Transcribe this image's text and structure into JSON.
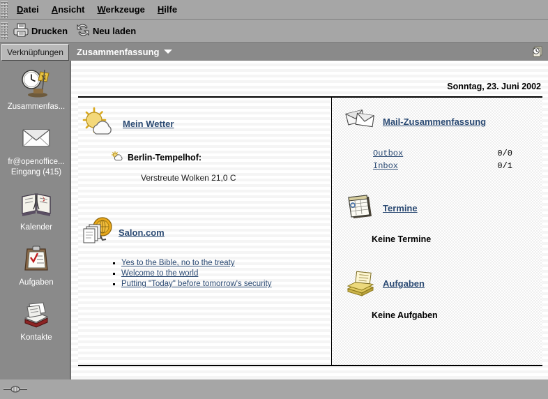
{
  "menubar": {
    "items": [
      {
        "label": "Datei",
        "accel": "D"
      },
      {
        "label": "Ansicht",
        "accel": "A"
      },
      {
        "label": "Werkzeuge",
        "accel": "W"
      },
      {
        "label": "Hilfe",
        "accel": "H"
      }
    ]
  },
  "toolbar": {
    "print_label": "Drucken",
    "print_icon": "printer-icon",
    "reload_label": "Neu laden",
    "reload_icon": "refresh-icon"
  },
  "viewbar": {
    "tab_label": "Verknüpfungen",
    "title": "Zusammenfassung",
    "dropdown_icon": "chevron-down-icon",
    "corner_icon": "summary-clock-icon"
  },
  "sidebar": {
    "items": [
      {
        "label": "Zusammenfas...",
        "label2": "",
        "icon": "clock-summary-icon"
      },
      {
        "label": "fr@openoffice...",
        "label2": "Eingang (415)",
        "icon": "envelope-icon"
      },
      {
        "label": "Kalender",
        "label2": "",
        "icon": "calendar-book-icon"
      },
      {
        "label": "Aufgaben",
        "label2": "",
        "icon": "clipboard-check-icon"
      },
      {
        "label": "Kontakte",
        "label2": "",
        "icon": "contacts-cardfile-icon"
      }
    ]
  },
  "content": {
    "date": "Sonntag, 23. Juni 2002",
    "weather": {
      "title": "Mein Wetter",
      "icon": "sun-cloud-icon",
      "station": "Berlin-Tempelhof:",
      "station_icon": "small-sun-cloud-icon",
      "condition": "Verstreute Wolken 21,0 C"
    },
    "news": {
      "title": "Salon.com",
      "icon": "news-documents-icon",
      "link_icon": "salon-globe-icon",
      "items": [
        "Yes to the Bible, no to the treaty",
        "Welcome to the world",
        "Putting \"Today\" before tomorrow's security"
      ]
    },
    "mail": {
      "title": "Mail-Zusammenfassung",
      "icon": "mail-stack-icon",
      "folders": [
        {
          "name": "Outbox",
          "count": "0/0"
        },
        {
          "name": "Inbox",
          "count": "0/1"
        }
      ]
    },
    "appointments": {
      "title": "Termine",
      "icon": "calendar-page-icon",
      "empty": "Keine Termine"
    },
    "tasks": {
      "title": "Aufgaben",
      "icon": "notes-stack-icon",
      "empty": "Keine Aufgaben"
    }
  },
  "statusbar": {
    "splitter_icon": "splitter-handle-icon"
  },
  "colors": {
    "chrome": "#a6a6a6",
    "viewbar": "#8a8a8a",
    "link": "#2b4a73",
    "panel": "#ffffff"
  }
}
